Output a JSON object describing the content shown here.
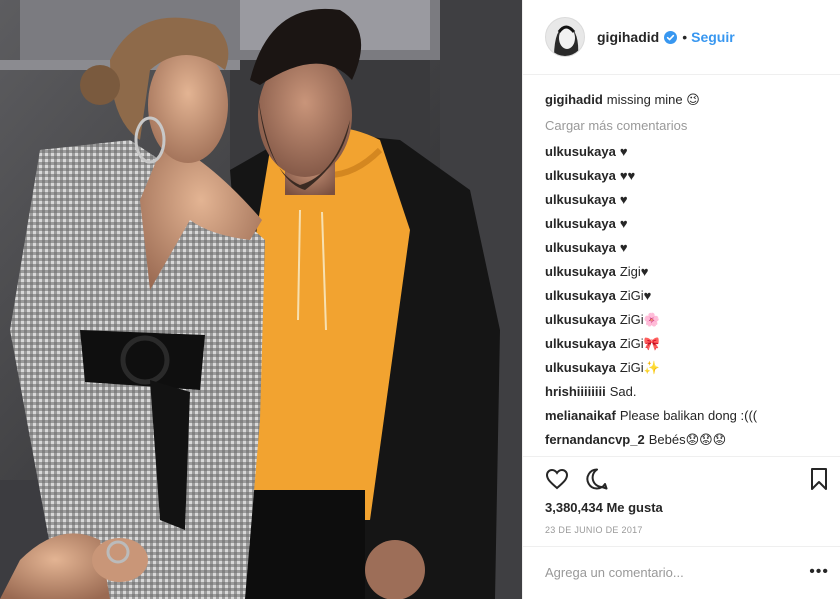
{
  "post": {
    "username": "gigihadid",
    "follow_label": "Seguir",
    "separator": "•",
    "caption_user": "gigihadid",
    "caption_text": "missing mine 😉",
    "load_more": "Cargar más comentarios",
    "likes": "3,380,434 Me gusta",
    "date": "23 DE JUNIO DE 2017",
    "add_comment_placeholder": "Agrega un comentario...",
    "more_options": "•••"
  },
  "comments": [
    {
      "user": "ulkusukaya",
      "text": "♥"
    },
    {
      "user": "ulkusukaya",
      "text": "♥♥"
    },
    {
      "user": "ulkusukaya",
      "text": "♥"
    },
    {
      "user": "ulkusukaya",
      "text": "♥"
    },
    {
      "user": "ulkusukaya",
      "text": "♥"
    },
    {
      "user": "ulkusukaya",
      "text": "Zigi♥"
    },
    {
      "user": "ulkusukaya",
      "text": "ZiGi♥"
    },
    {
      "user": "ulkusukaya",
      "text": "ZiGi🌸"
    },
    {
      "user": "ulkusukaya",
      "text": "ZiGi🎀"
    },
    {
      "user": "ulkusukaya",
      "text": "ZiGi✨"
    },
    {
      "user": "hrishiiiiiiii",
      "text": "Sad."
    },
    {
      "user": "melianaikaf",
      "text": "Please balikan dong :((("
    },
    {
      "user": "fernandancvp_2",
      "text": "Bebés😟😟😟"
    }
  ],
  "icons": {
    "like": "heart-icon",
    "comment": "comment-bubble-icon",
    "save": "bookmark-icon",
    "verified": "verified-badge-icon"
  },
  "colors": {
    "link": "#3897f0",
    "verified": "#3897f0",
    "muted": "#999999",
    "text": "#262626"
  }
}
